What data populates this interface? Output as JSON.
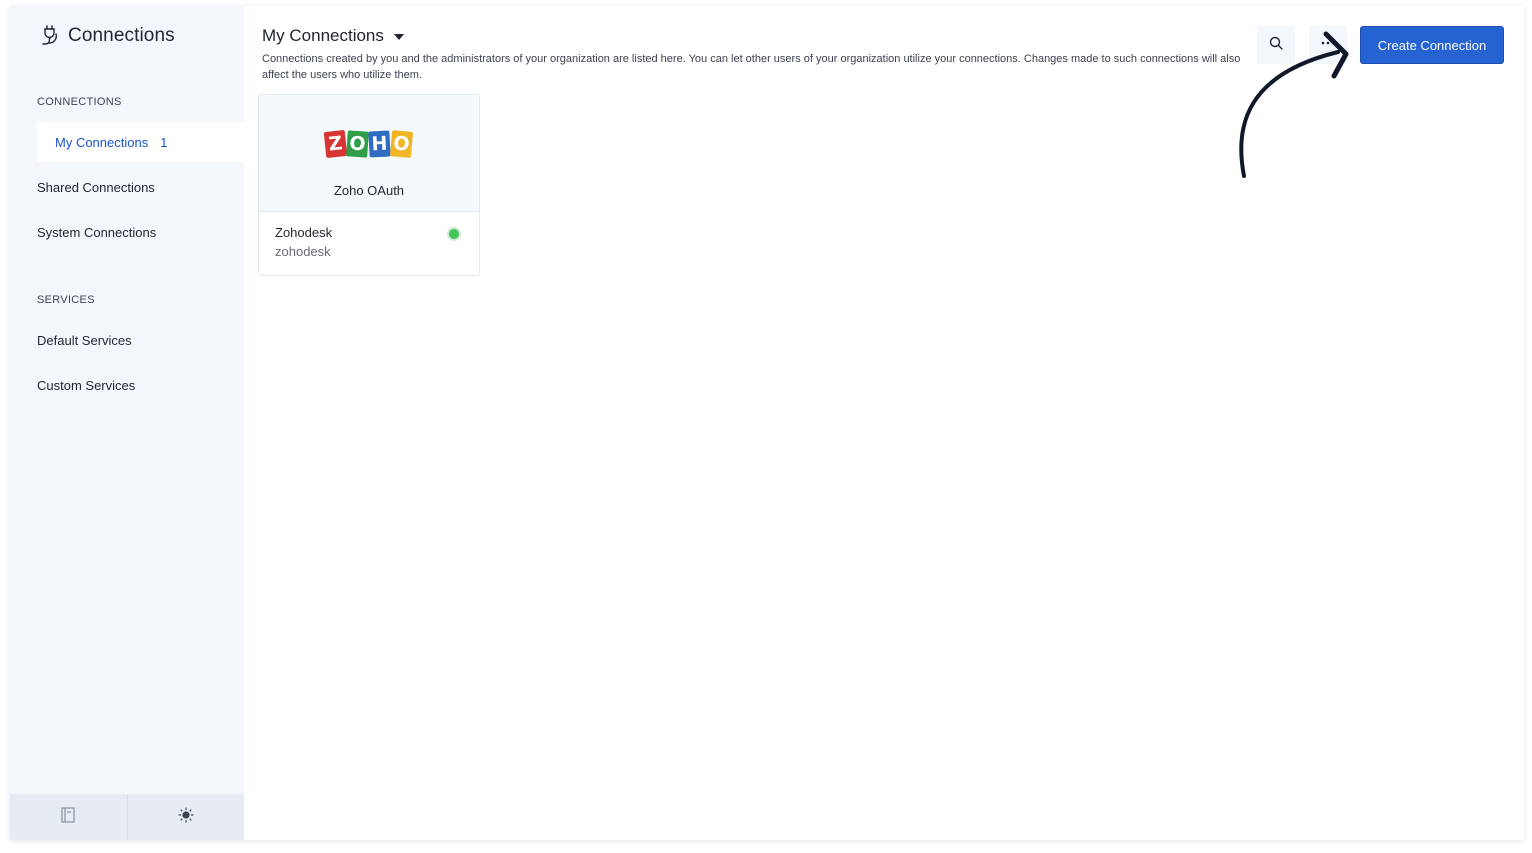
{
  "app": {
    "title": "Connections"
  },
  "sidebar": {
    "sections": [
      {
        "label": "CONNECTIONS",
        "items": [
          {
            "label": "My Connections",
            "count": "1",
            "active": true
          },
          {
            "label": "Shared Connections"
          },
          {
            "label": "System Connections"
          }
        ]
      },
      {
        "label": "SERVICES",
        "items": [
          {
            "label": "Default Services"
          },
          {
            "label": "Custom Services"
          }
        ]
      }
    ],
    "footer": {
      "left_icon": "book-icon",
      "right_icon": "sun-icon"
    }
  },
  "main": {
    "title": "My Connections",
    "description": "Connections created by you and the administrators of your organization are listed here. You can let other users of your organization utilize your connections. Changes made to such connections will also affect the users who utilize them.",
    "create_button": "Create Connection",
    "search_icon": "search-icon",
    "filter_icon": "more-icon"
  },
  "cards": [
    {
      "provider": "Zoho OAuth",
      "logo_letters": [
        "Z",
        "O",
        "H",
        "O"
      ],
      "logo_colors": [
        "#d63531",
        "#2f9e48",
        "#2f6bc1",
        "#f0b627"
      ],
      "name": "Zohodesk",
      "link_name": "zohodesk",
      "status_color": "#45c25a"
    }
  ],
  "colors": {
    "accent": "#2563d2",
    "active_nav_text": "#1b56c9",
    "sidebar_bg": "#f3f6fb"
  }
}
